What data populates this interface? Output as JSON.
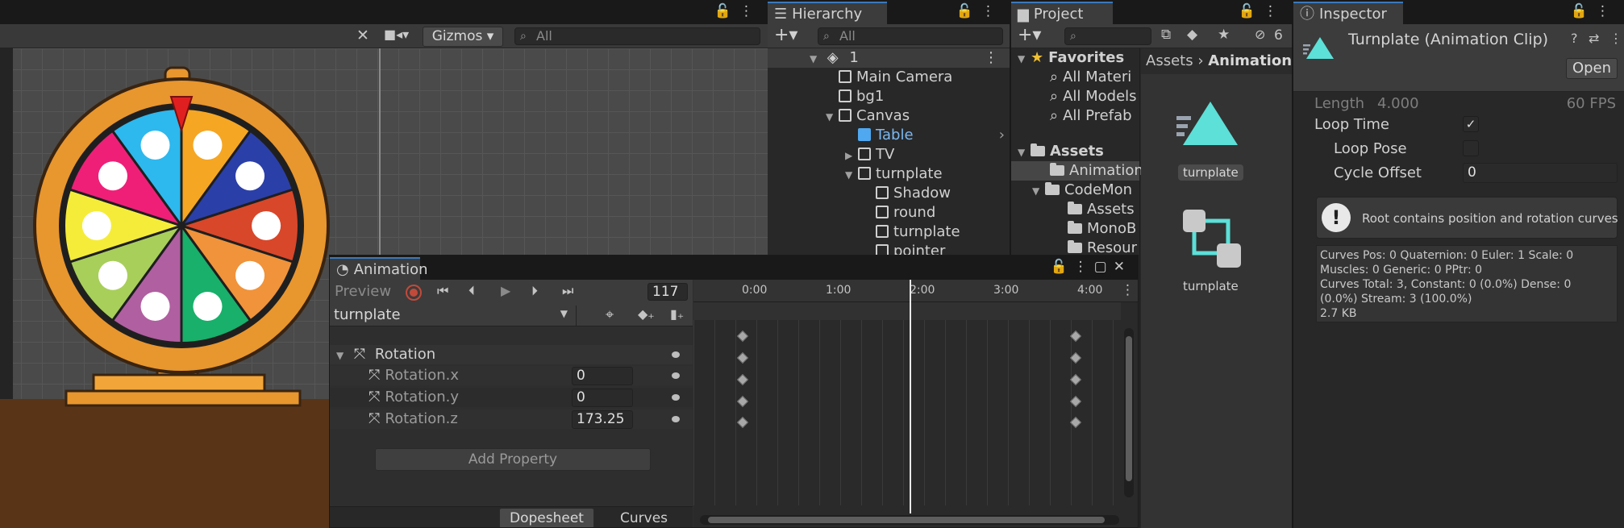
{
  "scene": {
    "gizmos_label": "Gizmos",
    "search_placeholder": "All"
  },
  "hierarchy": {
    "tab": "Hierarchy",
    "search_placeholder": "All",
    "scene_name": "1",
    "items": [
      {
        "label": "Main Camera"
      },
      {
        "label": "bg1"
      },
      {
        "label": "Canvas"
      },
      {
        "label": "Table"
      },
      {
        "label": "TV"
      },
      {
        "label": "turnplate"
      },
      {
        "label": "Shadow"
      },
      {
        "label": "round"
      },
      {
        "label": "turnplate"
      },
      {
        "label": "pointer"
      }
    ]
  },
  "project": {
    "tab": "Project",
    "hidden_count": "6",
    "favorites_label": "Favorites",
    "favorites": [
      {
        "label": "All Materi"
      },
      {
        "label": "All Models"
      },
      {
        "label": "All Prefab"
      }
    ],
    "assets_label": "Assets",
    "tree": [
      {
        "label": "Animation"
      },
      {
        "label": "CodeMon"
      },
      {
        "label": "Assets"
      },
      {
        "label": "MonoB"
      },
      {
        "label": "Resour"
      }
    ],
    "breadcrumb_root": "Assets",
    "breadcrumb_current": "Animations",
    "files": [
      {
        "label": "turnplate"
      },
      {
        "label": "turnplate"
      }
    ]
  },
  "inspector": {
    "tab": "Inspector",
    "title": "Turnplate (Animation Clip)",
    "open_label": "Open",
    "length_label": "Length",
    "length_value": "4.000",
    "fps_label": "60 FPS",
    "loop_time_label": "Loop Time",
    "loop_time_check": "✓",
    "loop_pose_label": "Loop Pose",
    "cycle_offset_label": "Cycle Offset",
    "cycle_offset_value": "0",
    "info_message": "Root contains position and rotation curves",
    "stats": [
      "Curves Pos: 0 Quaternion: 0 Euler: 1 Scale: 0",
      "Muscles: 0 Generic: 0 PPtr: 0",
      "Curves Total: 3, Constant: 0 (0.0%) Dense: 0",
      "(0.0%) Stream: 3 (100.0%)",
      "2.7 KB"
    ]
  },
  "animation": {
    "tab": "Animation",
    "preview_label": "Preview",
    "frame": "117",
    "clip_name": "turnplate",
    "ticks": [
      "0:00",
      "1:00",
      "2:00",
      "3:00",
      "4:00"
    ],
    "group_label": "Rotation",
    "properties": [
      {
        "label": "Rotation.x",
        "value": "0"
      },
      {
        "label": "Rotation.y",
        "value": "0"
      },
      {
        "label": "Rotation.z",
        "value": "173.25"
      }
    ],
    "add_property_label": "Add Property",
    "dopesheet_label": "Dopesheet",
    "curves_label": "Curves"
  },
  "colors": {
    "accent_blue": "#3a79bb",
    "wheel_rim": "#e8962e",
    "pointer_red": "#e02020",
    "record_red": "#c24a3a",
    "teal_icon": "#5ce0d8"
  }
}
